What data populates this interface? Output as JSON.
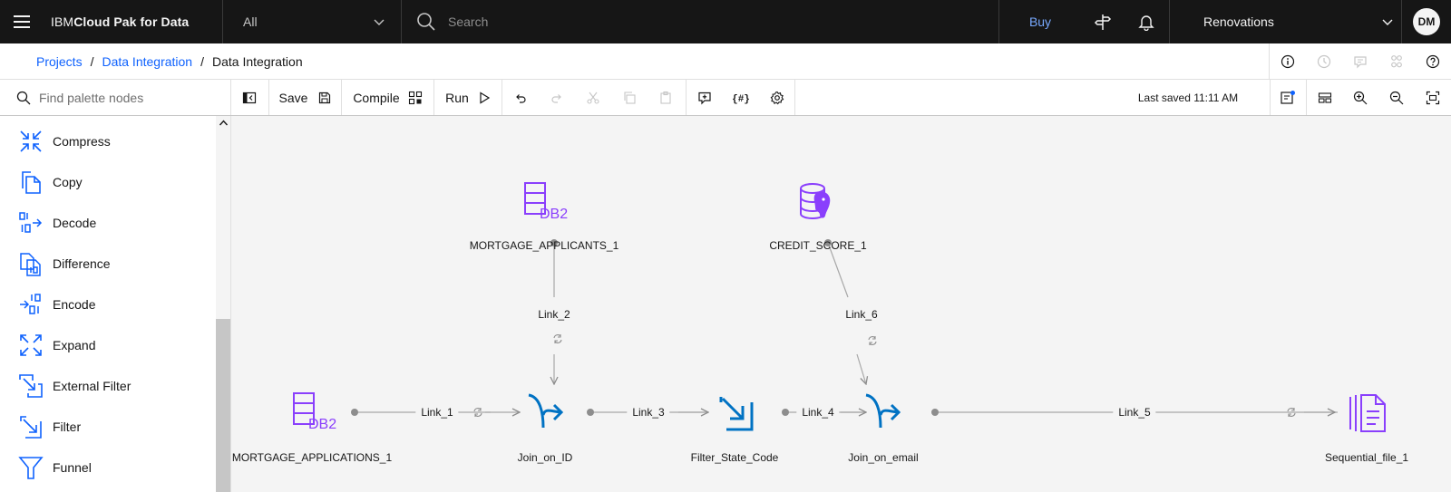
{
  "header": {
    "brand_regular": "IBM ",
    "brand_bold": "Cloud Pak for Data",
    "scope": "All",
    "search_placeholder": "Search",
    "buy": "Buy",
    "account": "Renovations",
    "avatar": "DM"
  },
  "breadcrumb": {
    "items": [
      "Projects",
      "Data Integration",
      "Data Integration"
    ],
    "separator": "/"
  },
  "toolbar": {
    "palette_search_placeholder": "Find palette nodes",
    "save": "Save",
    "compile": "Compile",
    "run": "Run",
    "last_saved": "Last saved 11:11 AM"
  },
  "palette": {
    "items": [
      {
        "label": "Compress",
        "icon": "compress-icon"
      },
      {
        "label": "Copy",
        "icon": "copy-icon"
      },
      {
        "label": "Decode",
        "icon": "decode-icon"
      },
      {
        "label": "Difference",
        "icon": "difference-icon"
      },
      {
        "label": "Encode",
        "icon": "encode-icon"
      },
      {
        "label": "Expand",
        "icon": "expand-icon"
      },
      {
        "label": "External Filter",
        "icon": "external-filter-icon"
      },
      {
        "label": "Filter",
        "icon": "filter-icon"
      },
      {
        "label": "Funnel",
        "icon": "funnel-icon"
      }
    ]
  },
  "canvas": {
    "nodes": {
      "mortgage_applicants": "MORTGAGE_APPLICANTS_1",
      "credit_score": "CREDIT_SCORE_1",
      "mortgage_applications": "MORTGAGE_APPLICATIONS_1",
      "join_on_id": "Join_on_ID",
      "filter_state_code": "Filter_State_Code",
      "join_on_email": "Join_on_email",
      "sequential_file": "Sequential_file_1"
    },
    "links": {
      "link_1": "Link_1",
      "link_2": "Link_2",
      "link_3": "Link_3",
      "link_4": "Link_4",
      "link_5": "Link_5",
      "link_6": "Link_6"
    },
    "db2_icon_text": "DB2"
  },
  "colors": {
    "accent": "#0f62fe",
    "purple": "#8a3ffc",
    "blue_node": "#0072c3",
    "topbar": "#161616"
  }
}
